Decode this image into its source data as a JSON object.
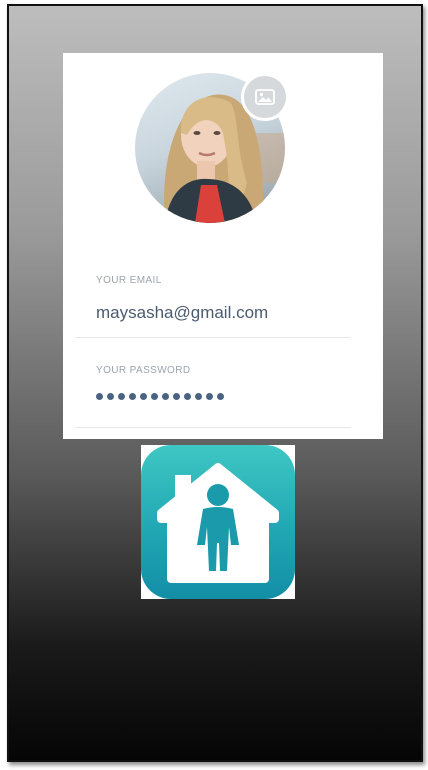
{
  "profile": {
    "avatar_icon": "avatar",
    "change_photo_icon": "image-icon"
  },
  "email": {
    "label": "YOUR EMAIL",
    "value": "maysasha@gmail.com"
  },
  "password": {
    "label": "YOUR PASSWORD",
    "mask_length": 12
  },
  "app_icon": {
    "icon": "house-person-icon",
    "colors": {
      "teal_top": "#3ec7c3",
      "teal_bottom": "#138ea6",
      "figure": "#1a9aab"
    }
  }
}
